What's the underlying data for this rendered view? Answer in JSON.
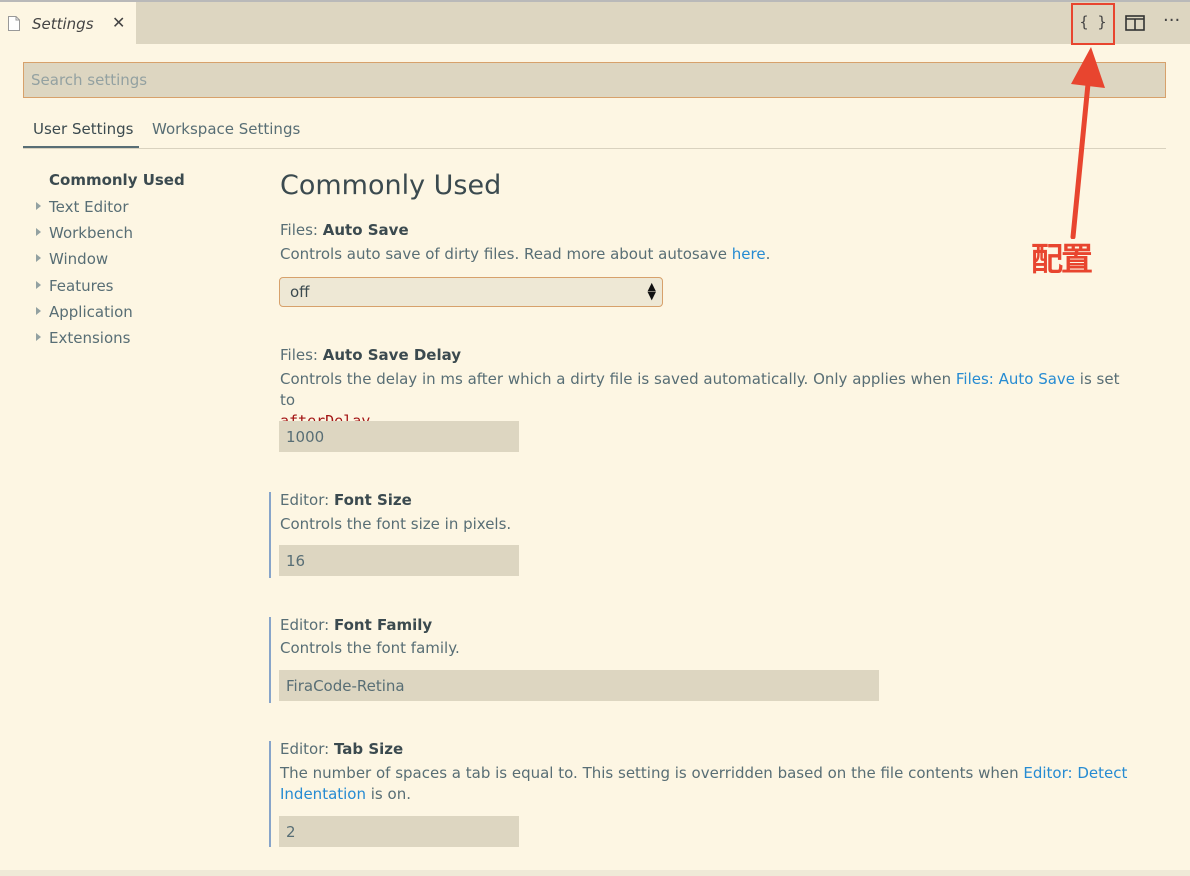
{
  "tab": {
    "title": "Settings",
    "close_glyph": "✕"
  },
  "actions": {
    "open_json_label": "{ }",
    "split_icon": "split-editor-icon",
    "more_label": "···"
  },
  "search": {
    "placeholder": "Search settings",
    "value": ""
  },
  "settings_tabs": [
    "User Settings",
    "Workspace Settings"
  ],
  "toc": {
    "header": "Commonly Used",
    "items": [
      "Text Editor",
      "Workbench",
      "Window",
      "Features",
      "Application",
      "Extensions"
    ]
  },
  "group_title": "Commonly Used",
  "settings": {
    "auto_save": {
      "category": "Files: ",
      "key": "Auto Save",
      "desc": "Controls auto save of dirty files. Read more about autosave ",
      "link": "here",
      "desc_end": ".",
      "value": "off"
    },
    "auto_save_delay": {
      "category": "Files: ",
      "key": "Auto Save Delay",
      "desc_1": "Controls the delay in ms after which a dirty file is saved automatically. Only applies when ",
      "link": "Files: Auto Save",
      "desc_2": " is set to",
      "code": "afterDelay",
      "desc_end": ".",
      "value": "1000"
    },
    "font_size": {
      "category": "Editor: ",
      "key": "Font Size",
      "desc": "Controls the font size in pixels.",
      "value": "16"
    },
    "font_family": {
      "category": "Editor: ",
      "key": "Font Family",
      "desc": "Controls the font family.",
      "value": "FiraCode-Retina"
    },
    "tab_size": {
      "category": "Editor: ",
      "key": "Tab Size",
      "desc_1": "The number of spaces a tab is equal to. This setting is overridden based on the file contents when ",
      "link_1": "Editor: Detect",
      "link_2": "Indentation",
      "desc_2": " is on.",
      "value": "2"
    }
  },
  "annotation": {
    "label": "配置",
    "color": "#E8452F"
  },
  "colors": {
    "background": "#FDF6E3",
    "tabbar": "#DDD6C1",
    "link": "#268BD2",
    "modified_indicator": "#87A4C9"
  }
}
